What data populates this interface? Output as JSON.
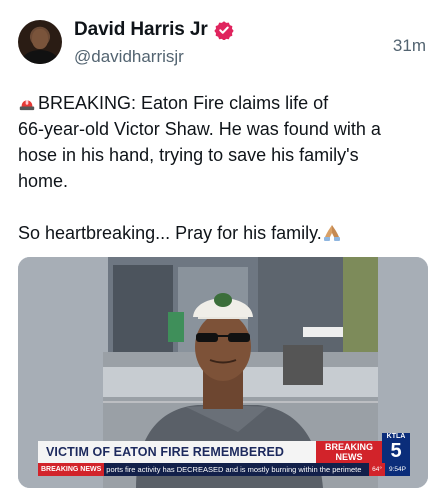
{
  "post": {
    "author_name": "David Harris Jr",
    "handle": "@davidharrisjr",
    "time": "31m",
    "verified_icon": "verified-badge-icon",
    "verified_color": "#e0245e",
    "text_lines": [
      "BREAKING: Eaton Fire claims life of",
      "66-year-old Victor Shaw. He was found with a",
      "hose in his hand, trying to save his family's",
      "home."
    ],
    "text_closing": "So heartbreaking... Pray for his family.",
    "leading_emoji": "police-light-icon",
    "trailing_emoji": "folded-hands-icon"
  },
  "media": {
    "lower_third_title": "VICTIM OF EATON FIRE REMEMBERED",
    "breaking_line1": "BREAKING",
    "breaking_line2": "NEWS",
    "station_top": "KTLA",
    "station_number": "5",
    "ticker_label": "BREAKING NEWS",
    "ticker_text": "ports fire activity has DECREASED and is mostly burning within the perimete",
    "ticker_temp": "64°",
    "ticker_time": "9:54P",
    "colors": {
      "news_red": "#d2232a",
      "news_blue": "#0b2d7a",
      "title_navy": "#1d2a5e"
    }
  }
}
